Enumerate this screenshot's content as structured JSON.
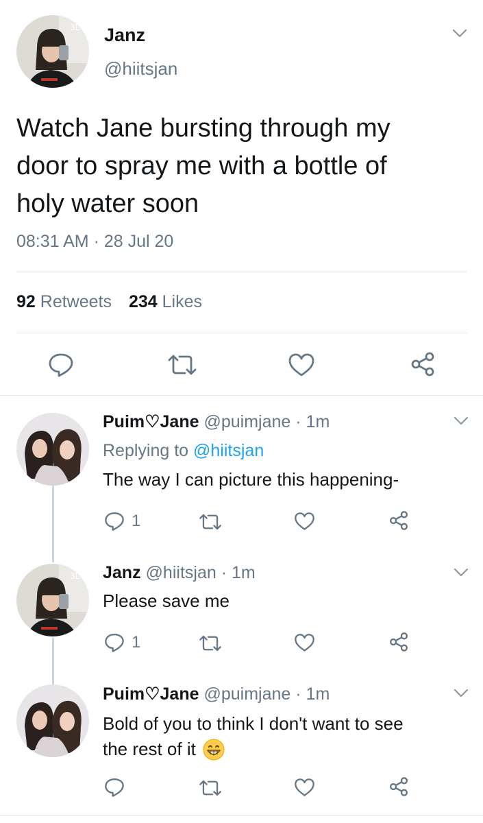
{
  "main_tweet": {
    "display_name": "Janz",
    "handle": "@hiitsjan",
    "text_lines": [
      "Watch Jane bursting through my",
      "door to spray me with a bottle of",
      "holy water soon"
    ],
    "timestamp": "08:31 AM · 28 Jul 20",
    "retweets_count": "92",
    "retweets_label": "Retweets",
    "likes_count": "234",
    "likes_label": "Likes"
  },
  "replies": [
    {
      "display_name": "Puim♡Jane",
      "handle": "@puimjane",
      "time": "· 1m",
      "replying_prefix": "Replying to",
      "replying_handle": "@hiitsjan",
      "text_lines": [
        "The way I can picture this happening-"
      ],
      "reply_count": "1"
    },
    {
      "display_name": "Janz",
      "handle": "@hiitsjan",
      "time": "· 1m",
      "text_lines": [
        "Please save me"
      ],
      "reply_count": "1"
    },
    {
      "display_name": "Puim♡Jane",
      "handle": "@puimjane",
      "time": "· 1m",
      "text_lines": [
        "Bold of you to think I don't want to see",
        "the rest of it"
      ],
      "reply_count": ""
    }
  ],
  "icons": {
    "chevron": "chevron-down-icon",
    "reply": "reply-icon",
    "retweet": "retweet-icon",
    "like": "heart-icon",
    "share": "share-icon",
    "emoji": "grinning-emoji-icon"
  },
  "colors": {
    "text": "#14171a",
    "secondary": "#657786",
    "link": "#1da1f2",
    "divider": "#e1e8ed"
  }
}
